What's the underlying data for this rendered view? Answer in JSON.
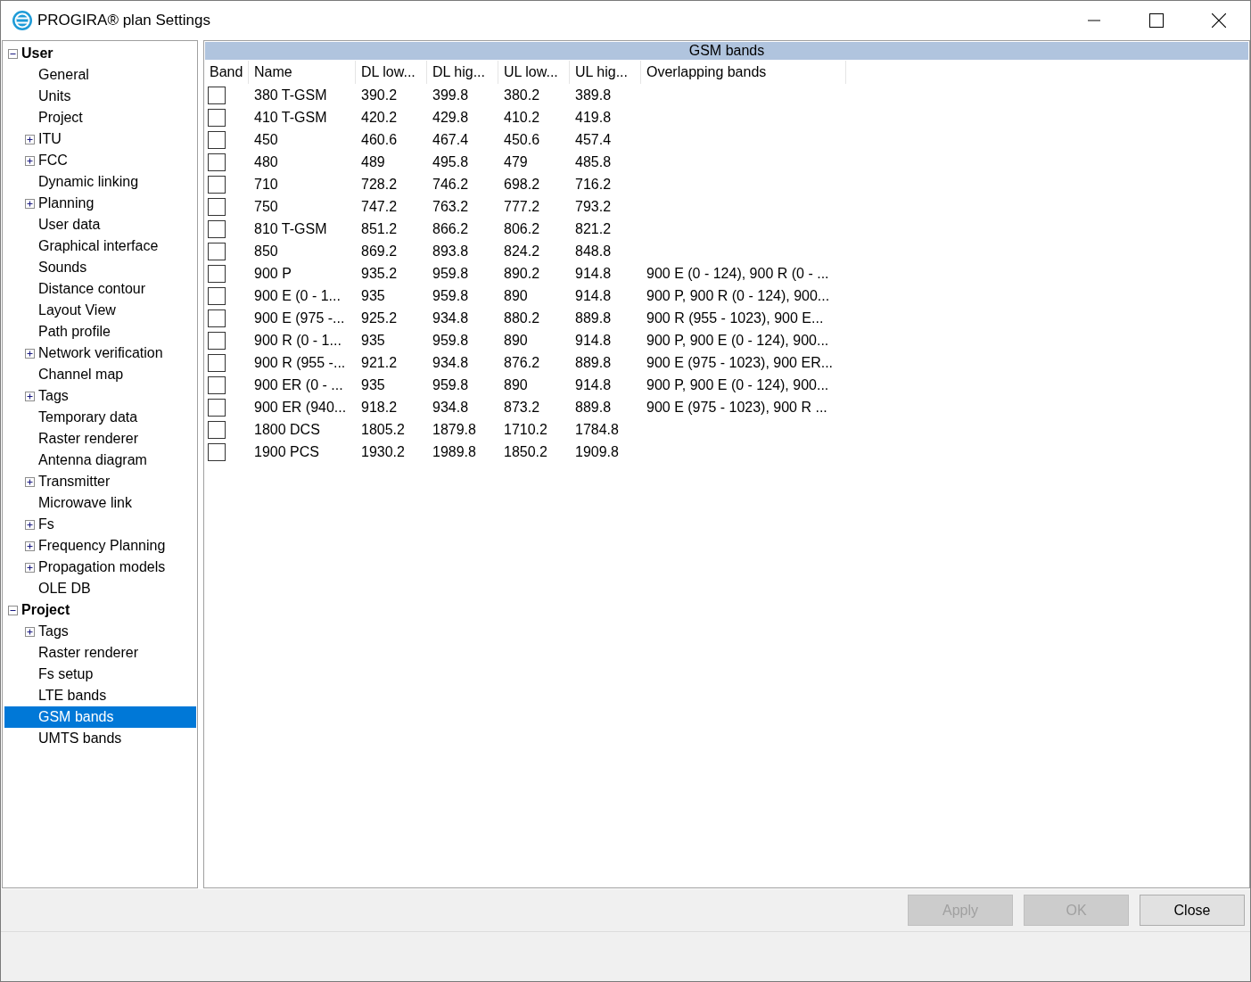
{
  "window": {
    "title": "PROGIRA® plan Settings"
  },
  "tree": [
    {
      "label": "User",
      "kind": "folder",
      "expanded": true,
      "selected": false,
      "children": [
        {
          "label": "General",
          "kind": "leaf",
          "selected": false
        },
        {
          "label": "Units",
          "kind": "leaf",
          "selected": false
        },
        {
          "label": "Project",
          "kind": "leaf",
          "selected": false
        },
        {
          "label": "ITU",
          "kind": "folder",
          "expanded": false,
          "selected": false
        },
        {
          "label": "FCC",
          "kind": "folder",
          "expanded": false,
          "selected": false
        },
        {
          "label": "Dynamic linking",
          "kind": "leaf",
          "selected": false
        },
        {
          "label": "Planning",
          "kind": "folder",
          "expanded": false,
          "selected": false
        },
        {
          "label": "User data",
          "kind": "leaf",
          "selected": false
        },
        {
          "label": "Graphical interface",
          "kind": "leaf",
          "selected": false
        },
        {
          "label": "Sounds",
          "kind": "leaf",
          "selected": false
        },
        {
          "label": "Distance contour",
          "kind": "leaf",
          "selected": false
        },
        {
          "label": "Layout View",
          "kind": "leaf",
          "selected": false
        },
        {
          "label": "Path profile",
          "kind": "leaf",
          "selected": false
        },
        {
          "label": "Network verification",
          "kind": "folder",
          "expanded": false,
          "selected": false
        },
        {
          "label": "Channel map",
          "kind": "leaf",
          "selected": false
        },
        {
          "label": "Tags",
          "kind": "folder",
          "expanded": false,
          "selected": false
        },
        {
          "label": "Temporary data",
          "kind": "leaf",
          "selected": false
        },
        {
          "label": "Raster renderer",
          "kind": "leaf",
          "selected": false
        },
        {
          "label": "Antenna diagram",
          "kind": "leaf",
          "selected": false
        },
        {
          "label": "Transmitter",
          "kind": "folder",
          "expanded": false,
          "selected": false
        },
        {
          "label": "Microwave link",
          "kind": "leaf",
          "selected": false
        },
        {
          "label": "Fs",
          "kind": "folder",
          "expanded": false,
          "selected": false
        },
        {
          "label": "Frequency Planning",
          "kind": "folder",
          "expanded": false,
          "selected": false
        },
        {
          "label": "Propagation models",
          "kind": "folder",
          "expanded": false,
          "selected": false
        },
        {
          "label": "OLE DB",
          "kind": "leaf",
          "selected": false
        }
      ]
    },
    {
      "label": "Project",
      "kind": "folder",
      "expanded": true,
      "selected": false,
      "children": [
        {
          "label": "Tags",
          "kind": "folder",
          "expanded": false,
          "selected": false
        },
        {
          "label": "Raster renderer",
          "kind": "leaf",
          "selected": false
        },
        {
          "label": "Fs setup",
          "kind": "leaf",
          "selected": false
        },
        {
          "label": "LTE bands",
          "kind": "leaf",
          "selected": false
        },
        {
          "label": "GSM bands",
          "kind": "leaf",
          "selected": true
        },
        {
          "label": "UMTS bands",
          "kind": "leaf",
          "selected": false
        }
      ]
    }
  ],
  "table": {
    "title": "GSM bands",
    "columns": [
      "Band",
      "Name",
      "DL low...",
      "DL hig...",
      "UL low...",
      "UL hig...",
      "Overlapping bands"
    ],
    "rows": [
      {
        "checked": false,
        "cells": [
          "",
          "380 T-GSM",
          "390.2",
          "399.8",
          "380.2",
          "389.8",
          ""
        ]
      },
      {
        "checked": false,
        "cells": [
          "",
          "410 T-GSM",
          "420.2",
          "429.8",
          "410.2",
          "419.8",
          ""
        ]
      },
      {
        "checked": false,
        "cells": [
          "",
          "450",
          "460.6",
          "467.4",
          "450.6",
          "457.4",
          ""
        ]
      },
      {
        "checked": false,
        "cells": [
          "",
          "480",
          "489",
          "495.8",
          "479",
          "485.8",
          ""
        ]
      },
      {
        "checked": false,
        "cells": [
          "",
          "710",
          "728.2",
          "746.2",
          "698.2",
          "716.2",
          ""
        ]
      },
      {
        "checked": false,
        "cells": [
          "",
          "750",
          "747.2",
          "763.2",
          "777.2",
          "793.2",
          ""
        ]
      },
      {
        "checked": false,
        "cells": [
          "",
          "810 T-GSM",
          "851.2",
          "866.2",
          "806.2",
          "821.2",
          ""
        ]
      },
      {
        "checked": false,
        "cells": [
          "",
          "850",
          "869.2",
          "893.8",
          "824.2",
          "848.8",
          ""
        ]
      },
      {
        "checked": false,
        "cells": [
          "",
          "900 P",
          "935.2",
          "959.8",
          "890.2",
          "914.8",
          "900 E (0 - 124), 900 R (0 - ..."
        ]
      },
      {
        "checked": false,
        "cells": [
          "",
          "900 E (0 - 1...",
          "935",
          "959.8",
          "890",
          "914.8",
          "900 P, 900 R (0 - 124), 900..."
        ]
      },
      {
        "checked": false,
        "cells": [
          "",
          "900 E (975 -...",
          "925.2",
          "934.8",
          "880.2",
          "889.8",
          "900 R (955 - 1023), 900 E..."
        ]
      },
      {
        "checked": false,
        "cells": [
          "",
          "900 R (0 - 1...",
          "935",
          "959.8",
          "890",
          "914.8",
          "900 P, 900 E (0 - 124), 900..."
        ]
      },
      {
        "checked": false,
        "cells": [
          "",
          "900 R (955 -...",
          "921.2",
          "934.8",
          "876.2",
          "889.8",
          "900 E (975 - 1023), 900 ER..."
        ]
      },
      {
        "checked": false,
        "cells": [
          "",
          "900 ER (0 - ...",
          "935",
          "959.8",
          "890",
          "914.8",
          "900 P, 900 E (0 - 124), 900..."
        ]
      },
      {
        "checked": false,
        "cells": [
          "",
          "900 ER (940...",
          "918.2",
          "934.8",
          "873.2",
          "889.8",
          "900 E (975 - 1023), 900 R ..."
        ]
      },
      {
        "checked": false,
        "cells": [
          "",
          "1800 DCS",
          "1805.2",
          "1879.8",
          "1710.2",
          "1784.8",
          ""
        ]
      },
      {
        "checked": false,
        "cells": [
          "",
          "1900 PCS",
          "1930.2",
          "1989.8",
          "1850.2",
          "1909.8",
          ""
        ]
      }
    ]
  },
  "buttons": [
    {
      "label": "Apply",
      "disabled": true
    },
    {
      "label": "OK",
      "disabled": true
    },
    {
      "label": "Close",
      "disabled": false
    }
  ]
}
